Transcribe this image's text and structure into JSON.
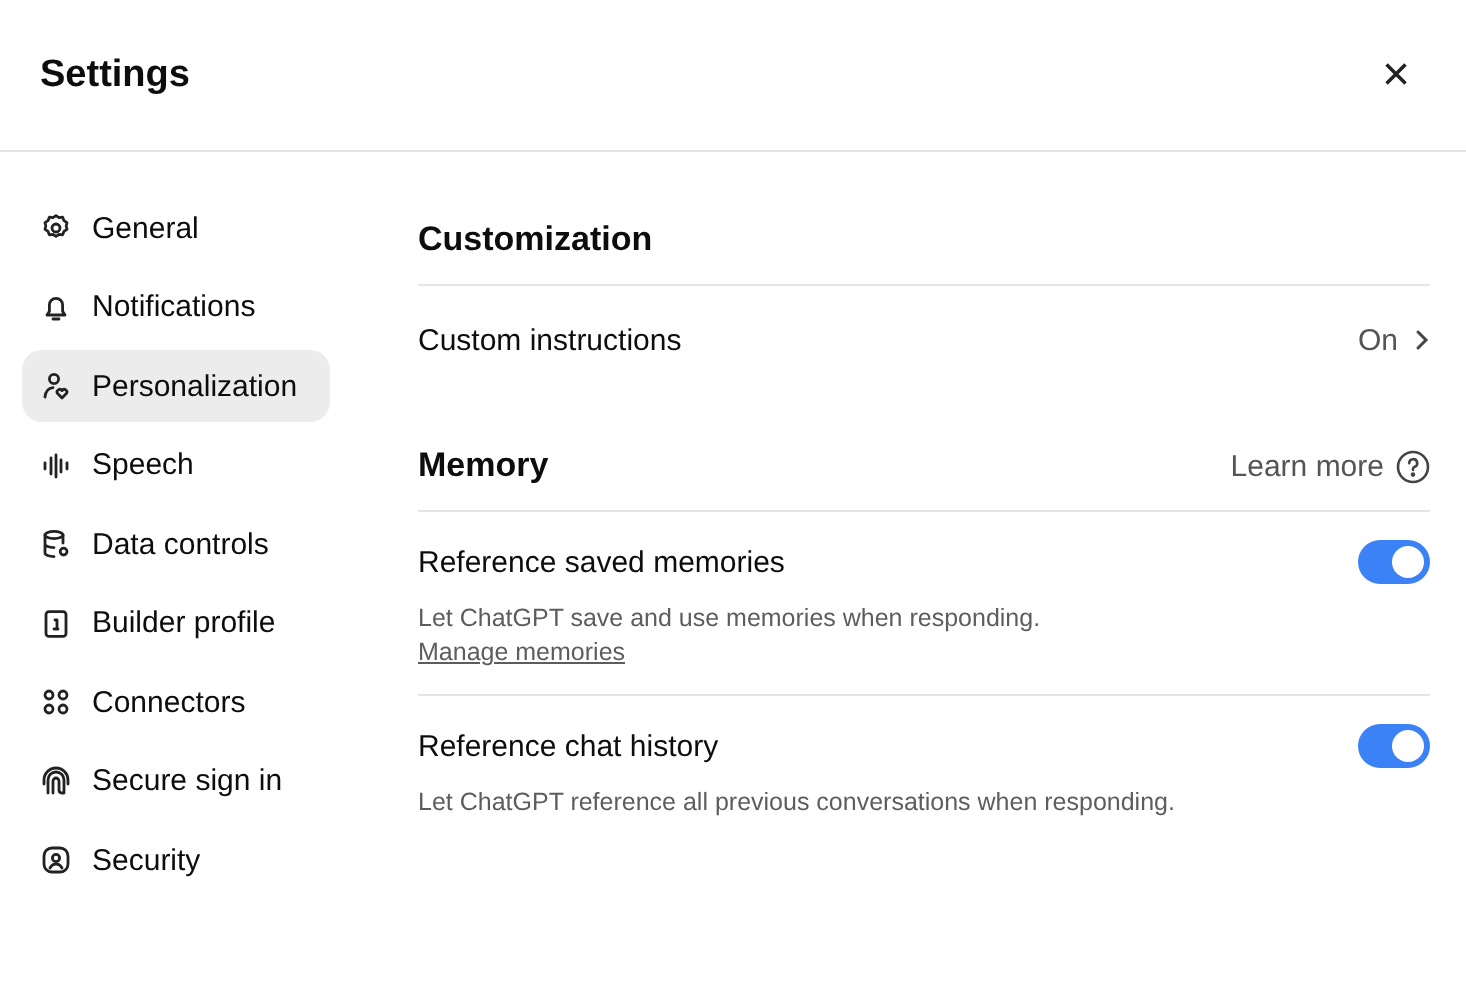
{
  "window": {
    "title": "Settings",
    "close": "×"
  },
  "sidebar": {
    "items": [
      {
        "label": "General",
        "selected": false
      },
      {
        "label": "Notifications",
        "selected": false
      },
      {
        "label": "Personalization",
        "selected": true
      },
      {
        "label": "Speech",
        "selected": false
      },
      {
        "label": "Data controls",
        "selected": false
      },
      {
        "label": "Builder profile",
        "selected": false
      },
      {
        "label": "Connectors",
        "selected": false
      },
      {
        "label": "Secure sign in",
        "selected": false
      },
      {
        "label": "Security",
        "selected": false
      }
    ]
  },
  "customization": {
    "title": "Customization",
    "rows": [
      {
        "label": "Custom instructions",
        "value": "On"
      }
    ]
  },
  "memory": {
    "title": "Memory",
    "learn_more": "Learn more",
    "items": [
      {
        "label": "Reference saved memories",
        "on": true,
        "description": "Let ChatGPT save and use memories when responding.",
        "link": "Manage memories"
      },
      {
        "label": "Reference chat history",
        "on": true,
        "description": "Let ChatGPT reference all previous conversations when responding."
      }
    ]
  }
}
